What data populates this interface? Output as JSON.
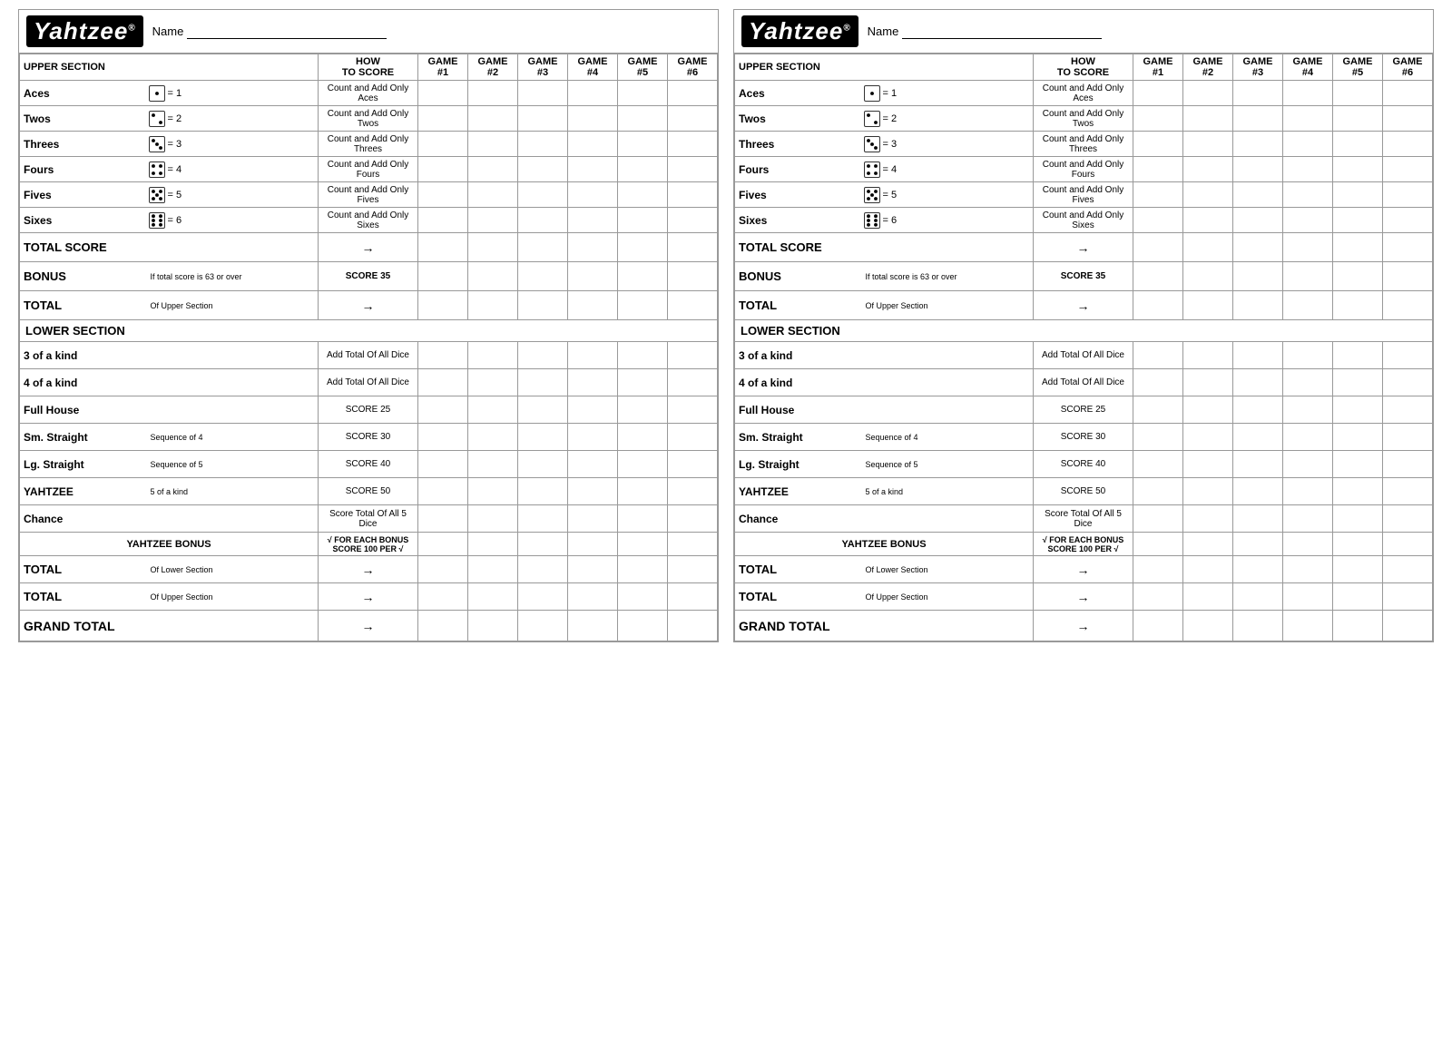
{
  "cards": [
    {
      "id": "left",
      "logo": "Yahtzee",
      "logo_reg": "®",
      "name_label": "Name",
      "upper_section": "UPPER SECTION",
      "how_to_score": "HOW TO SCORE",
      "games": [
        "GAME #1",
        "GAME #2",
        "GAME #3",
        "GAME #4",
        "GAME #5",
        "GAME #6"
      ],
      "rows_upper": [
        {
          "label": "Aces",
          "dice": "1",
          "eq": "= 1",
          "howto": "Count and Add Only Aces"
        },
        {
          "label": "Twos",
          "dice": "2",
          "eq": "= 2",
          "howto": "Count and Add Only Twos"
        },
        {
          "label": "Threes",
          "dice": "3",
          "eq": "= 3",
          "howto": "Count and Add Only Threes"
        },
        {
          "label": "Fours",
          "dice": "4",
          "eq": "= 4",
          "howto": "Count and Add Only Fours"
        },
        {
          "label": "Fives",
          "dice": "5",
          "eq": "= 5",
          "howto": "Count and Add Only Fives"
        },
        {
          "label": "Sixes",
          "dice": "6",
          "eq": "= 6",
          "howto": "Count and Add Only Sixes"
        }
      ],
      "total_score_label": "TOTAL SCORE",
      "total_score_arrow": "→",
      "bonus_label": "BONUS",
      "bonus_sub": "If total score is 63 or over",
      "bonus_score": "SCORE 35",
      "total_upper_label": "TOTAL",
      "total_upper_sub": "Of Upper Section",
      "total_upper_arrow": "→",
      "lower_section": "LOWER SECTION",
      "rows_lower": [
        {
          "label": "3 of a kind",
          "sub": "",
          "howto": "Add Total Of All Dice"
        },
        {
          "label": "4 of a kind",
          "sub": "",
          "howto": "Add Total Of All Dice"
        },
        {
          "label": "Full House",
          "sub": "",
          "howto": "SCORE 25"
        },
        {
          "label": "Sm. Straight",
          "sub": "Sequence of 4",
          "howto": "SCORE 30"
        },
        {
          "label": "Lg. Straight",
          "sub": "Sequence of 5",
          "howto": "SCORE 40"
        },
        {
          "label": "YAHTZEE",
          "sub": "5 of a kind",
          "howto": "SCORE 50"
        },
        {
          "label": "Chance",
          "sub": "",
          "howto": "Score Total Of All 5 Dice"
        }
      ],
      "yahtzee_bonus_label": "YAHTZEE BONUS",
      "yahtzee_bonus_line1": "√ FOR EACH BONUS",
      "yahtzee_bonus_line2": "SCORE 100 PER √",
      "total_lower_label": "TOTAL",
      "total_lower_sub": "Of Lower Section",
      "total_lower_arrow": "→",
      "total_upper2_label": "TOTAL",
      "total_upper2_sub": "Of Upper Section",
      "total_upper2_arrow": "→",
      "grand_total_label": "GRAND TOTAL",
      "grand_total_arrow": "→"
    },
    {
      "id": "right",
      "logo": "Yahtzee",
      "logo_reg": "®",
      "name_label": "Name",
      "upper_section": "UPPER SECTION",
      "how_to_score": "HOW TO SCORE",
      "games": [
        "GAME #1",
        "GAME #2",
        "GAME #3",
        "GAME #4",
        "GAME #5",
        "GAME #6"
      ],
      "rows_upper": [
        {
          "label": "Aces",
          "dice": "1",
          "eq": "= 1",
          "howto": "Count and Add Only Aces"
        },
        {
          "label": "Twos",
          "dice": "2",
          "eq": "= 2",
          "howto": "Count and Add Only Twos"
        },
        {
          "label": "Threes",
          "dice": "3",
          "eq": "= 3",
          "howto": "Count and Add Only Threes"
        },
        {
          "label": "Fours",
          "dice": "4",
          "eq": "= 4",
          "howto": "Count and Add Only Fours"
        },
        {
          "label": "Fives",
          "dice": "5",
          "eq": "= 5",
          "howto": "Count and Add Only Fives"
        },
        {
          "label": "Sixes",
          "dice": "6",
          "eq": "= 6",
          "howto": "Count and Add Only Sixes"
        }
      ],
      "total_score_label": "TOTAL SCORE",
      "total_score_arrow": "→",
      "bonus_label": "BONUS",
      "bonus_sub": "If total score is 63 or over",
      "bonus_score": "SCORE 35",
      "total_upper_label": "TOTAL",
      "total_upper_sub": "Of Upper Section",
      "total_upper_arrow": "→",
      "lower_section": "LOWER SECTION",
      "rows_lower": [
        {
          "label": "3 of a kind",
          "sub": "",
          "howto": "Add Total Of All Dice"
        },
        {
          "label": "4 of a kind",
          "sub": "",
          "howto": "Add Total Of All Dice"
        },
        {
          "label": "Full House",
          "sub": "",
          "howto": "SCORE 25"
        },
        {
          "label": "Sm. Straight",
          "sub": "Sequence of 4",
          "howto": "SCORE 30"
        },
        {
          "label": "Lg. Straight",
          "sub": "Sequence of 5",
          "howto": "SCORE 40"
        },
        {
          "label": "YAHTZEE",
          "sub": "5 of a kind",
          "howto": "SCORE 50"
        },
        {
          "label": "Chance",
          "sub": "",
          "howto": "Score Total Of All 5 Dice"
        }
      ],
      "yahtzee_bonus_label": "YAHTZEE BONUS",
      "yahtzee_bonus_line1": "√ FOR EACH BONUS",
      "yahtzee_bonus_line2": "SCORE 100 PER √",
      "total_lower_label": "TOTAL",
      "total_lower_sub": "Of Lower Section",
      "total_lower_arrow": "→",
      "total_upper2_label": "TOTAL",
      "total_upper2_sub": "Of Upper Section",
      "total_upper2_arrow": "→",
      "grand_total_label": "GRAND TOTAL",
      "grand_total_arrow": "→"
    }
  ]
}
